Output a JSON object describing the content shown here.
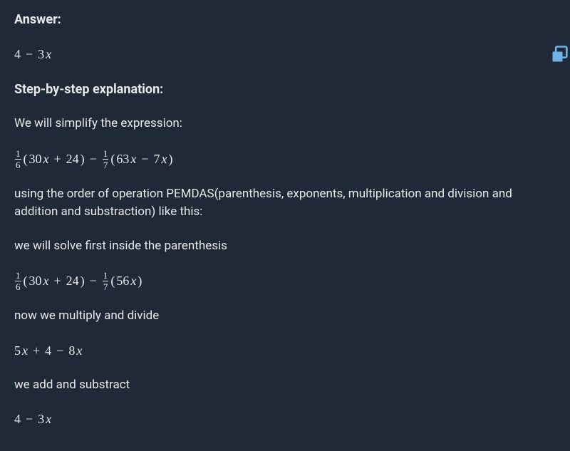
{
  "answer_heading": "Answer:",
  "answer_math": {
    "a": "4",
    "op1": "−",
    "b": "3",
    "var": "x"
  },
  "step_heading": "Step-by-step explanation:",
  "line1": "We will simplify the expression:",
  "expr1": {
    "f1n": "1",
    "f1d": "6",
    "p1a": "30",
    "p1var": "x",
    "p1op": "+",
    "p1b": "24",
    "mid_op": "−",
    "f2n": "1",
    "f2d": "7",
    "p2a": "63",
    "p2var": "x",
    "p2op": "−",
    "p2b": "7",
    "p2var2": "x"
  },
  "line2": "using the order of operation PEMDAS(parenthesis, exponents, multiplication and division and addition and substraction) like this:",
  "line3": "we will solve first inside the parenthesis",
  "expr2": {
    "f1n": "1",
    "f1d": "6",
    "p1a": "30",
    "p1var": "x",
    "p1op": "+",
    "p1b": "24",
    "mid_op": "−",
    "f2n": "1",
    "f2d": "7",
    "p2a": "56",
    "p2var": "x"
  },
  "line4": "now we multiply and divide",
  "expr3": {
    "a": "5",
    "var1": "x",
    "op1": "+",
    "b": "4",
    "op2": "−",
    "c": "8",
    "var2": "x"
  },
  "line5": "we add and substract",
  "expr4": {
    "a": "4",
    "op1": "−",
    "b": "3",
    "var": "x"
  }
}
